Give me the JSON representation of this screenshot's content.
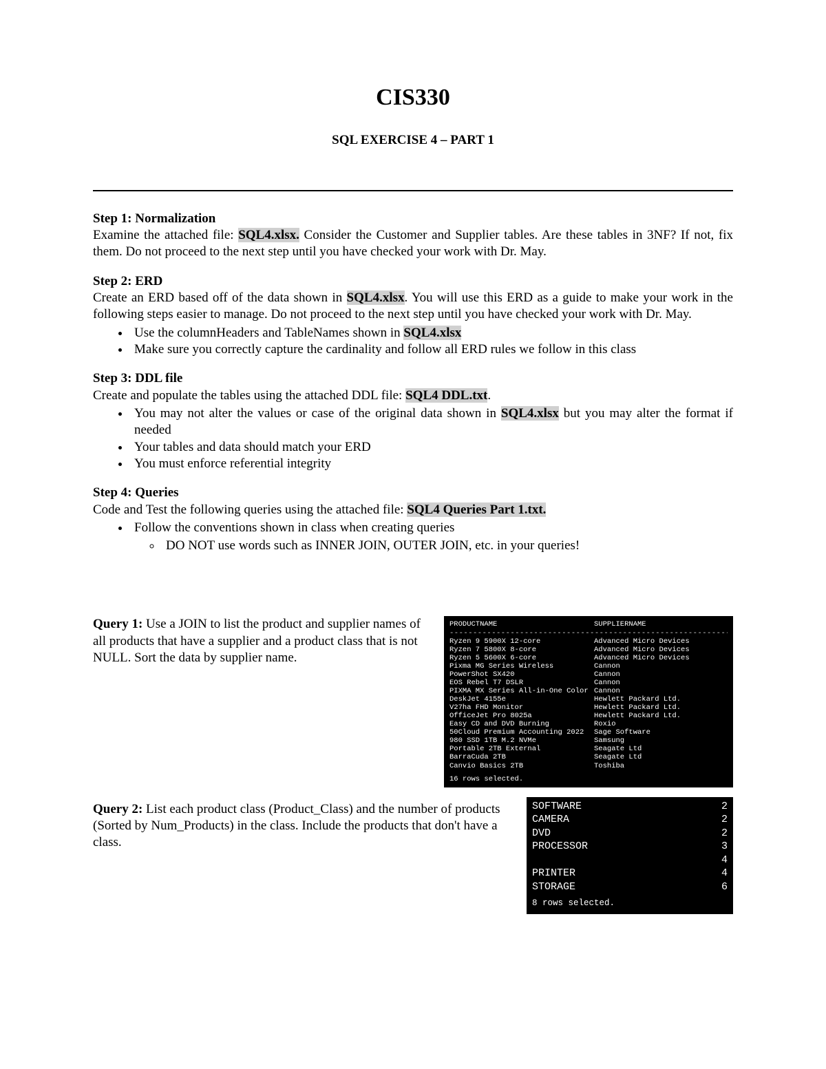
{
  "title": "CIS330",
  "subtitle": "SQL EXERCISE 4 – PART 1",
  "step1": {
    "heading": "Step 1:  Normalization",
    "body_prefix": "Examine the attached file: ",
    "file": "SQL4.xlsx.",
    "body_suffix": " Consider the Customer and Supplier tables. Are these tables in 3NF? If not, fix them. Do not proceed to the next step until you have checked your work with Dr. May."
  },
  "step2": {
    "heading": "Step 2: ERD",
    "body_prefix": "Create an ERD based off of the data shown in ",
    "file": "SQL4.xlsx",
    "body_suffix": ". You will use this ERD as a guide to make your work in the following steps easier to manage. Do not proceed to the next step until you have checked your work with Dr. May.",
    "bullets": [
      {
        "prefix": "Use the columnHeaders and TableNames shown in ",
        "file": "SQL4.xlsx",
        "suffix": ""
      },
      {
        "prefix": "Make sure you correctly capture the cardinality and follow all ERD rules we follow in this class",
        "file": "",
        "suffix": ""
      }
    ]
  },
  "step3": {
    "heading": "Step 3: DDL file",
    "body_prefix": "Create and populate the tables using the attached DDL file: ",
    "file": "SQL4 DDL.txt",
    "body_suffix": ".",
    "bullets": [
      {
        "prefix": "You may not alter the values or case of the original data shown in ",
        "file": "SQL4.xlsx",
        "suffix": " but you may alter the format if needed"
      },
      {
        "prefix": "Your tables and data should match your ERD",
        "file": "",
        "suffix": ""
      },
      {
        "prefix": "You must enforce referential integrity",
        "file": "",
        "suffix": ""
      }
    ]
  },
  "step4": {
    "heading": "Step 4:  Queries",
    "body_prefix": "Code and Test the following queries using the attached file: ",
    "file": "SQL4 Queries Part 1.txt.",
    "body_suffix": "",
    "bullet1": "Follow the conventions shown in class when creating queries",
    "subbullet": "DO NOT use words such as INNER JOIN, OUTER JOIN, etc. in your queries!"
  },
  "q1": {
    "label": "Query 1:",
    "text": " Use a JOIN to list the product and supplier names of all products that have a supplier and a product class that is not NULL. Sort the data by supplier name.",
    "term": {
      "col1": "PRODUCTNAME",
      "col2": "SUPPLIERNAME",
      "rows": [
        {
          "p": "Ryzen 9 5900X 12-core",
          "s": "Advanced Micro Devices"
        },
        {
          "p": "Ryzen 7 5800X 8-core",
          "s": "Advanced Micro Devices"
        },
        {
          "p": "Ryzen 5 5600X 6-core",
          "s": "Advanced Micro Devices"
        },
        {
          "p": "Pixma MG Series Wireless",
          "s": "Cannon"
        },
        {
          "p": "PowerShot SX420",
          "s": "Cannon"
        },
        {
          "p": "EOS Rebel T7 DSLR",
          "s": "Cannon"
        },
        {
          "p": "PIXMA MX Series All-in-One Color",
          "s": "Cannon"
        },
        {
          "p": "DeskJet 4155e",
          "s": "Hewlett Packard Ltd."
        },
        {
          "p": "V27ha FHD Monitor",
          "s": "Hewlett Packard Ltd."
        },
        {
          "p": "OfficeJet Pro 8025a",
          "s": "Hewlett Packard Ltd."
        },
        {
          "p": "Easy CD and DVD Burning",
          "s": "Roxio"
        },
        {
          "p": "50Cloud Premium Accounting 2022",
          "s": "Sage Software"
        },
        {
          "p": "980 SSD 1TB M.2 NVMe",
          "s": "Samsung"
        },
        {
          "p": "Portable 2TB External",
          "s": "Seagate Ltd"
        },
        {
          "p": "BarraCuda 2TB",
          "s": "Seagate Ltd"
        },
        {
          "p": "Canvio Basics 2TB",
          "s": "Toshiba"
        }
      ],
      "footer": "16 rows selected."
    }
  },
  "q2": {
    "label": "Query 2:",
    "text": " List each product class (Product_Class) and the number of products (Sorted by Num_Products) in the class. Include the products that don't have a class.",
    "term": {
      "rows": [
        {
          "c": "SOFTWARE",
          "n": "2"
        },
        {
          "c": "CAMERA",
          "n": "2"
        },
        {
          "c": "DVD",
          "n": "2"
        },
        {
          "c": "PROCESSOR",
          "n": "3"
        },
        {
          "c": "",
          "n": "4"
        },
        {
          "c": "PRINTER",
          "n": "4"
        },
        {
          "c": "STORAGE",
          "n": "6"
        }
      ],
      "footer": "8 rows selected."
    }
  }
}
